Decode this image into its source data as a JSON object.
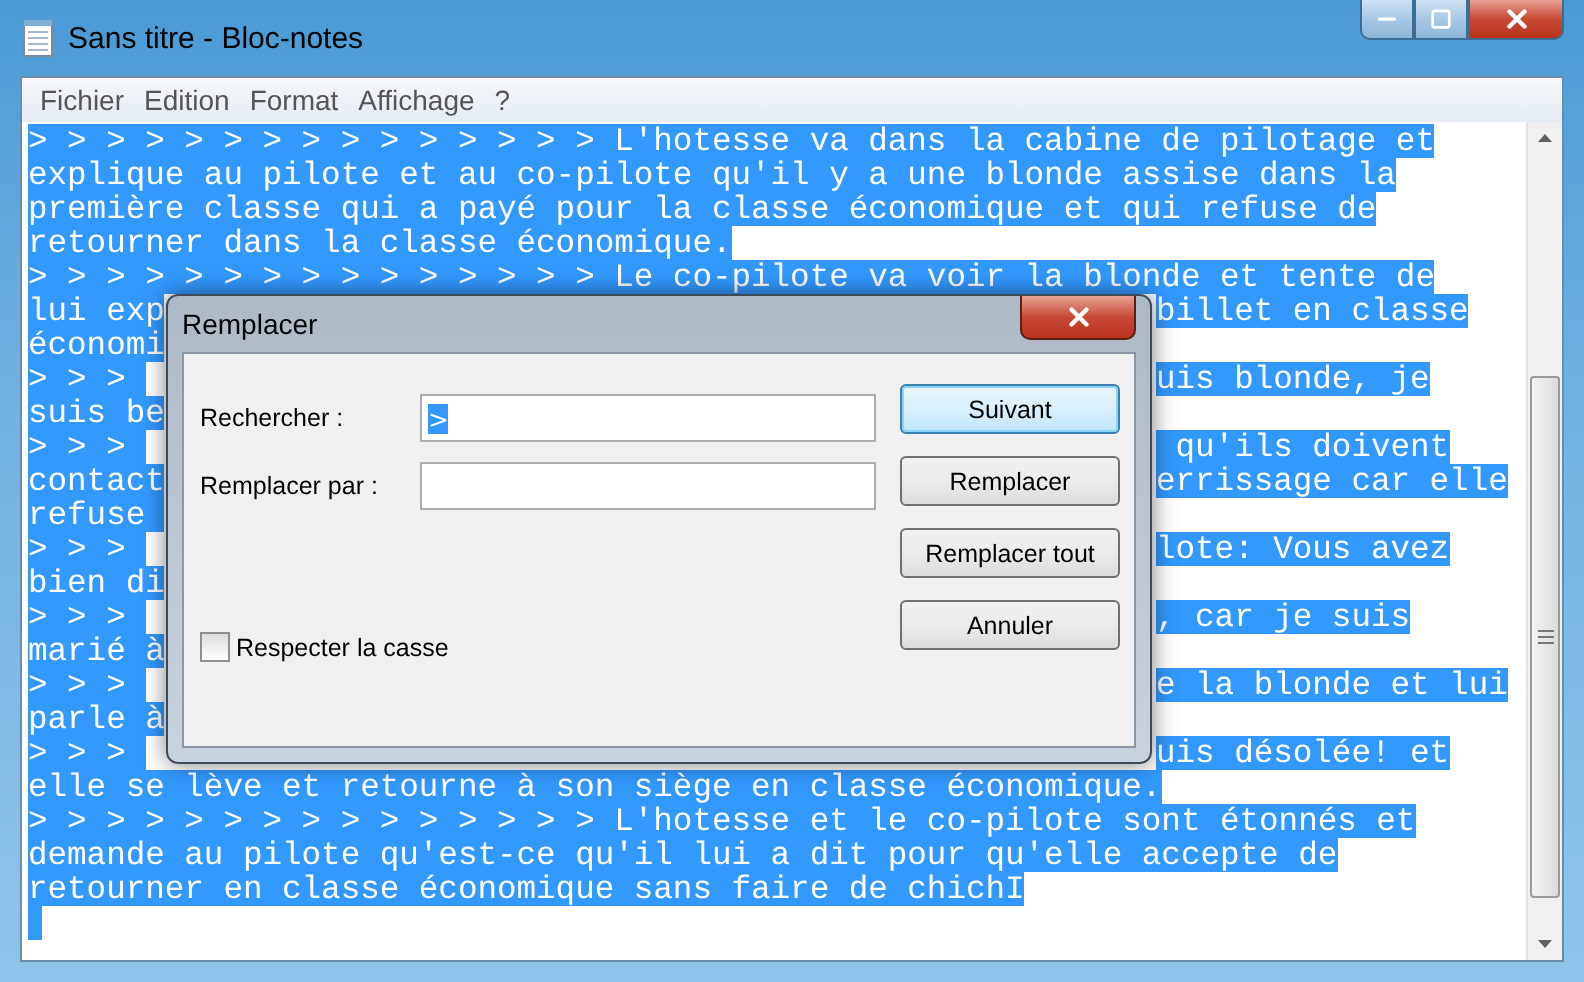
{
  "window": {
    "title": "Sans titre - Bloc-notes"
  },
  "menu": [
    "Fichier",
    "Edition",
    "Format",
    "Affichage",
    "?"
  ],
  "editor": {
    "lines": [
      {
        "kind": "full",
        "text": "> > > > > > > > > > > > > > > L'hotesse va dans la cabine de pilotage et"
      },
      {
        "kind": "full",
        "text": "explique au pilote et au co-pilote qu'il y a une blonde assise dans la"
      },
      {
        "kind": "full",
        "text": "première classe qui a payé pour la classe économique et qui refuse de"
      },
      {
        "kind": "full",
        "text": "retourner dans la classe économique."
      },
      {
        "kind": "full",
        "text": "> > > > > > > > > > > > > > > Le co-pilote va voir la blonde et tente de"
      },
      {
        "kind": "split",
        "left": "lui exp",
        "right": "billet en classe"
      },
      {
        "kind": "split",
        "left": "économi"
      },
      {
        "kind": "split",
        "left": "> > > ",
        "right": "uis blonde, je"
      },
      {
        "kind": "split",
        "left": "suis be"
      },
      {
        "kind": "split",
        "left": "> > > ",
        "right": " qu'ils doivent"
      },
      {
        "kind": "split",
        "left": "contact",
        "right": "errissage car elle"
      },
      {
        "kind": "split",
        "left": "refuse "
      },
      {
        "kind": "split",
        "left": "> > > ",
        "right": "lote: Vous avez"
      },
      {
        "kind": "split",
        "left": "bien di"
      },
      {
        "kind": "split",
        "left": "> > > ",
        "right": ", car je suis"
      },
      {
        "kind": "split",
        "left": "marié à"
      },
      {
        "kind": "split",
        "left": "> > > ",
        "right": "e la blonde et lui"
      },
      {
        "kind": "split",
        "left": "parle à"
      },
      {
        "kind": "split",
        "left": "> > > ",
        "right": "uis désolée! et"
      },
      {
        "kind": "full",
        "text": "elle se lève et retourne à son siège en classe économique."
      },
      {
        "kind": "full",
        "text": "> > > > > > > > > > > > > > > L'hotesse et le co-pilote sont étonnés et"
      },
      {
        "kind": "full",
        "text": "demande au pilote qu'est-ce qu'il lui a dit pour qu'elle accepte de"
      },
      {
        "kind": "full",
        "text": "retourner en classe économique sans faire de chichI"
      },
      {
        "kind": "caret"
      }
    ]
  },
  "dialog": {
    "title": "Remplacer",
    "fields": [
      {
        "label": "Rechercher :",
        "value": ">"
      },
      {
        "label": "Remplacer par :"
      }
    ],
    "checkbox": {
      "label": "Respecter la casse",
      "checked": false
    },
    "buttons": [
      {
        "label": "Suivant",
        "selected": true
      },
      {
        "label": "Remplacer",
        "selected": false
      },
      {
        "label": "Remplacer tout",
        "selected": false
      },
      {
        "label": "Annuler",
        "selected": false
      }
    ]
  }
}
